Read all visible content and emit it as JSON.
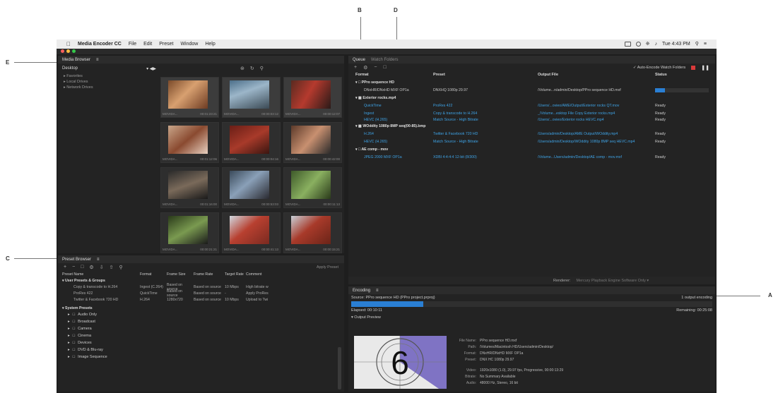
{
  "callouts": [
    "B",
    "D",
    "E",
    "C",
    "A"
  ],
  "menubar": {
    "app_name": "Media Encoder CC",
    "items": [
      "File",
      "Edit",
      "Preset",
      "Window",
      "Help"
    ],
    "clock": "Tue 4:43 PM"
  },
  "media_browser": {
    "title": "Media Browser",
    "location": "Desktop",
    "tree": [
      "Favorites",
      "Local Drives",
      "Network Drives"
    ],
    "thumbnails": [
      {
        "name": "MOVIDA...",
        "duration": "00:01:23:21"
      },
      {
        "name": "MOVIDA...",
        "duration": "00:00:03:12"
      },
      {
        "name": "MOVIDA...",
        "duration": "00:00:12:07"
      },
      {
        "name": "MOVIDA...",
        "duration": "00:01:12:06"
      },
      {
        "name": "MOVIDA...",
        "duration": "00:00:04:16"
      },
      {
        "name": "MOVIDA...",
        "duration": "00:00:42:00"
      },
      {
        "name": "MOVIDA...",
        "duration": "00:01:16:00"
      },
      {
        "name": "MOVIDA...",
        "duration": "00:00:53:03"
      },
      {
        "name": "MOVIDA...",
        "duration": "00:00:11:13"
      },
      {
        "name": "MOVIDA...",
        "duration": "00:00:21:21"
      },
      {
        "name": "MOVIDA...",
        "duration": "00:00:41:13"
      },
      {
        "name": "MOVIDA...",
        "duration": "00:00:15:21"
      }
    ]
  },
  "preset_browser": {
    "title": "Preset Browser",
    "apply_label": "Apply Preset",
    "columns": [
      "Preset Name",
      "Format",
      "Frame Size",
      "Frame Rate",
      "Target Rate",
      "Comment"
    ],
    "user_group": "User Presets & Groups",
    "user_presets": [
      {
        "name": "Copy & transcode to H.264",
        "format": "Ingest (C.264)",
        "size": "Based on source",
        "rate": "Based on source",
        "target": "10 Mbps",
        "comment": "High bitrate w"
      },
      {
        "name": "ProRes 422",
        "format": "QuickTime",
        "size": "Based on source",
        "rate": "Based on source",
        "target": "-",
        "comment": "Apply ProRes"
      },
      {
        "name": "Twitter & Facebook 720 HD",
        "format": "H.264",
        "size": "1280x720",
        "rate": "Based on source",
        "target": "10 Mbps",
        "comment": "Upload to Twi"
      }
    ],
    "system_group": "System Presets",
    "system_items": [
      "Audio Only",
      "Broadcast",
      "Camera",
      "Cinema",
      "Devices",
      "DVD & Blu-ray",
      "Image Sequence"
    ]
  },
  "queue": {
    "tabs": [
      "Queue",
      "Watch Folders"
    ],
    "auto_encode": "Auto-Encode Watch Folders",
    "columns": [
      "Format",
      "Preset",
      "Output File",
      "Status"
    ],
    "groups": [
      {
        "source": "PPro sequence HD",
        "items": [
          {
            "format": "DNxHR/DNxHD MXF OP1a",
            "preset": "DNXHQ 1080p 29.97",
            "output": "/Volume...n/admin/Desktop/PPro sequence HD.mxf",
            "status": "",
            "progress": 0.18
          }
        ]
      },
      {
        "source": "Exterior rocks.mp4",
        "items": [
          {
            "format": "QuickTime",
            "preset": "ProRes 422",
            "output": "/Users/...ovieo/AME/Output/Exterior rocks QT.mov",
            "status": "Ready"
          },
          {
            "format": "Ingest",
            "preset": "Copy & transcode to H.264",
            "output": "_/Volume...esktop File Copy Exterior rocks.mp4",
            "status": "Ready"
          },
          {
            "format": "HEVC (H.265)",
            "preset": "Match Source - High Bitrate",
            "output": "/Users/...ovieo/Exterior rocks HEVC.mp4",
            "status": "Ready"
          }
        ]
      },
      {
        "source": "WOddity 1080p 8MP seq(00-85).bmp",
        "items": [
          {
            "format": "H.264",
            "preset": "Twitter & Facebook 720 HD",
            "output": "/Users/admin/Desktop/AME Output/WOddity.mp4",
            "status": "Ready"
          },
          {
            "format": "HEVC (H.265)",
            "preset": "Match Source - High Bitrate",
            "output": "/Users/admin/Desktop/WOddity 1080p 8MP seq HEVC.mp4",
            "status": "Ready"
          }
        ]
      },
      {
        "source": "AE comp - mov",
        "items": [
          {
            "format": "JPEG 2000 MXF OP1a",
            "preset": "XDBI 4:4:4:4 12-bit (8/300)",
            "output": "/Volume...Users/admin/Desktop/AE comp - mov.mxf",
            "status": "Ready"
          }
        ]
      }
    ],
    "renderer_label": "Renderer:",
    "renderer_value": "Mercury Playback Engine Software Only"
  },
  "encoding": {
    "title": "Encoding",
    "source": "Source: PPro sequence HD (PPro project.prproj)",
    "output_count": "1 output encoding",
    "elapsed": "Elapsed: 00:10:11",
    "remaining": "Remaining: 00:25:08",
    "progress": 0.2,
    "output_preview": "Output Preview",
    "preview_number": "6",
    "meta": [
      {
        "k": "File Name:",
        "v": "PPro sequence HD.mxf"
      },
      {
        "k": "Path:",
        "v": "/Volumes/Macintosh HD/Users/admin/Desktop/"
      },
      {
        "k": "Format:",
        "v": "DNxHR/DNxHD MXF OP1a"
      },
      {
        "k": "Preset:",
        "v": "DNX HC 1080p 29.97"
      },
      {
        "k": "Video:",
        "v": "1920x1080 (1.0), 29.97 fps, Progressive, 00:00:13:29"
      },
      {
        "k": "Bitrate:",
        "v": "No Summary Available"
      },
      {
        "k": "Audio:",
        "v": "48000 Hz, Stereo, 16 bit"
      }
    ]
  }
}
